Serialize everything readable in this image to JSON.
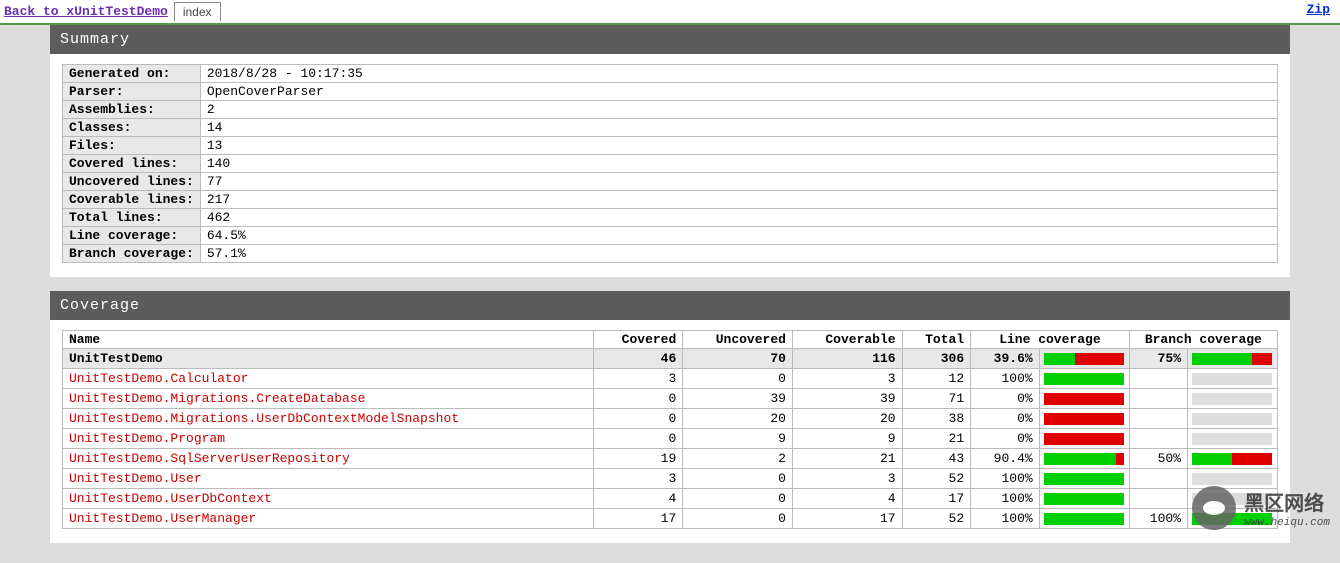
{
  "header": {
    "back_label": "Back to xUnitTestDemo",
    "tab_label": "index",
    "zip_label": "Zip"
  },
  "summary": {
    "title": "Summary",
    "rows": [
      {
        "label": "Generated on:",
        "value": "2018/8/28 - 10:17:35"
      },
      {
        "label": "Parser:",
        "value": "OpenCoverParser"
      },
      {
        "label": "Assemblies:",
        "value": "2"
      },
      {
        "label": "Classes:",
        "value": "14"
      },
      {
        "label": "Files:",
        "value": "13"
      },
      {
        "label": "Covered lines:",
        "value": "140"
      },
      {
        "label": "Uncovered lines:",
        "value": "77"
      },
      {
        "label": "Coverable lines:",
        "value": "217"
      },
      {
        "label": "Total lines:",
        "value": "462"
      },
      {
        "label": "Line coverage:",
        "value": "64.5%"
      },
      {
        "label": "Branch coverage:",
        "value": "57.1%"
      }
    ]
  },
  "coverage": {
    "title": "Coverage",
    "columns": {
      "name": "Name",
      "covered": "Covered",
      "uncovered": "Uncovered",
      "coverable": "Coverable",
      "total": "Total",
      "line_coverage": "Line coverage",
      "branch_coverage": "Branch coverage"
    },
    "assembly": {
      "name": "UnitTestDemo",
      "covered": "46",
      "uncovered": "70",
      "coverable": "116",
      "total": "306",
      "line_pct": "39.6%",
      "line_green": 39.6,
      "line_red": 60.4,
      "branch_pct": "75%",
      "branch_green": 75,
      "branch_red": 25
    },
    "classes": [
      {
        "name": "UnitTestDemo.Calculator",
        "covered": "3",
        "uncovered": "0",
        "coverable": "3",
        "total": "12",
        "line_pct": "100%",
        "line_green": 100,
        "line_red": 0,
        "branch_pct": "",
        "branch_green": null,
        "branch_red": null
      },
      {
        "name": "UnitTestDemo.Migrations.CreateDatabase",
        "covered": "0",
        "uncovered": "39",
        "coverable": "39",
        "total": "71",
        "line_pct": "0%",
        "line_green": 0,
        "line_red": 100,
        "branch_pct": "",
        "branch_green": null,
        "branch_red": null
      },
      {
        "name": "UnitTestDemo.Migrations.UserDbContextModelSnapshot",
        "covered": "0",
        "uncovered": "20",
        "coverable": "20",
        "total": "38",
        "line_pct": "0%",
        "line_green": 0,
        "line_red": 100,
        "branch_pct": "",
        "branch_green": null,
        "branch_red": null
      },
      {
        "name": "UnitTestDemo.Program",
        "covered": "0",
        "uncovered": "9",
        "coverable": "9",
        "total": "21",
        "line_pct": "0%",
        "line_green": 0,
        "line_red": 100,
        "branch_pct": "",
        "branch_green": null,
        "branch_red": null
      },
      {
        "name": "UnitTestDemo.SqlServerUserRepository",
        "covered": "19",
        "uncovered": "2",
        "coverable": "21",
        "total": "43",
        "line_pct": "90.4%",
        "line_green": 90.4,
        "line_red": 9.6,
        "branch_pct": "50%",
        "branch_green": 50,
        "branch_red": 50
      },
      {
        "name": "UnitTestDemo.User",
        "covered": "3",
        "uncovered": "0",
        "coverable": "3",
        "total": "52",
        "line_pct": "100%",
        "line_green": 100,
        "line_red": 0,
        "branch_pct": "",
        "branch_green": null,
        "branch_red": null
      },
      {
        "name": "UnitTestDemo.UserDbContext",
        "covered": "4",
        "uncovered": "0",
        "coverable": "4",
        "total": "17",
        "line_pct": "100%",
        "line_green": 100,
        "line_red": 0,
        "branch_pct": "",
        "branch_green": null,
        "branch_red": null
      },
      {
        "name": "UnitTestDemo.UserManager",
        "covered": "17",
        "uncovered": "0",
        "coverable": "17",
        "total": "52",
        "line_pct": "100%",
        "line_green": 100,
        "line_red": 0,
        "branch_pct": "100%",
        "branch_green": 100,
        "branch_red": 0
      }
    ]
  },
  "watermark": {
    "zh": "黑区网络",
    "url": "www.heiqu.com"
  }
}
